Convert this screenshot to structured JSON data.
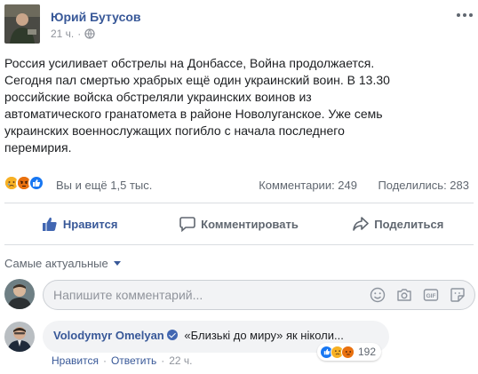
{
  "post": {
    "author": "Юрий Бутусов",
    "time": "21 ч.",
    "body": "Россия усиливает обстрелы на Донбассе, Война продолжается.\nСегодня пал смертью храбрых ещё один украинский воин. В 13.30\nроссийские войска обстреляли украинских воинов из\nавтоматического гранатомета в районе Новолуганское. Уже семь\nукраинских военнослужащих погибло с начала последнего\nперемирия."
  },
  "stats": {
    "reactions_text": "Вы и ещё 1,5 тыс.",
    "comments": "Комментарии: 249",
    "shares": "Поделились: 283"
  },
  "actions": {
    "like": "Нравится",
    "comment": "Комментировать",
    "share": "Поделиться"
  },
  "comments_section": {
    "sort_label": "Самые актуальные",
    "composer_placeholder": "Напишите комментарий...",
    "top_comment": {
      "author": "Volodymyr Omelyan",
      "text": "«Близькі до миру» як ніколи...",
      "reaction_count": "192",
      "like_link": "Нравится",
      "reply_link": "Ответить",
      "time": "22 ч."
    }
  },
  "colors": {
    "link_blue": "#385898",
    "facebook_blue": "#4267b2",
    "muted": "#606770",
    "light_muted": "#90949c"
  },
  "icons": [
    "globe-icon",
    "more-icon",
    "sad-icon",
    "angry-icon",
    "like-icon",
    "comment-icon",
    "share-icon",
    "emoji-icon",
    "camera-icon",
    "gif-icon",
    "sticker-icon",
    "verified-icon"
  ]
}
